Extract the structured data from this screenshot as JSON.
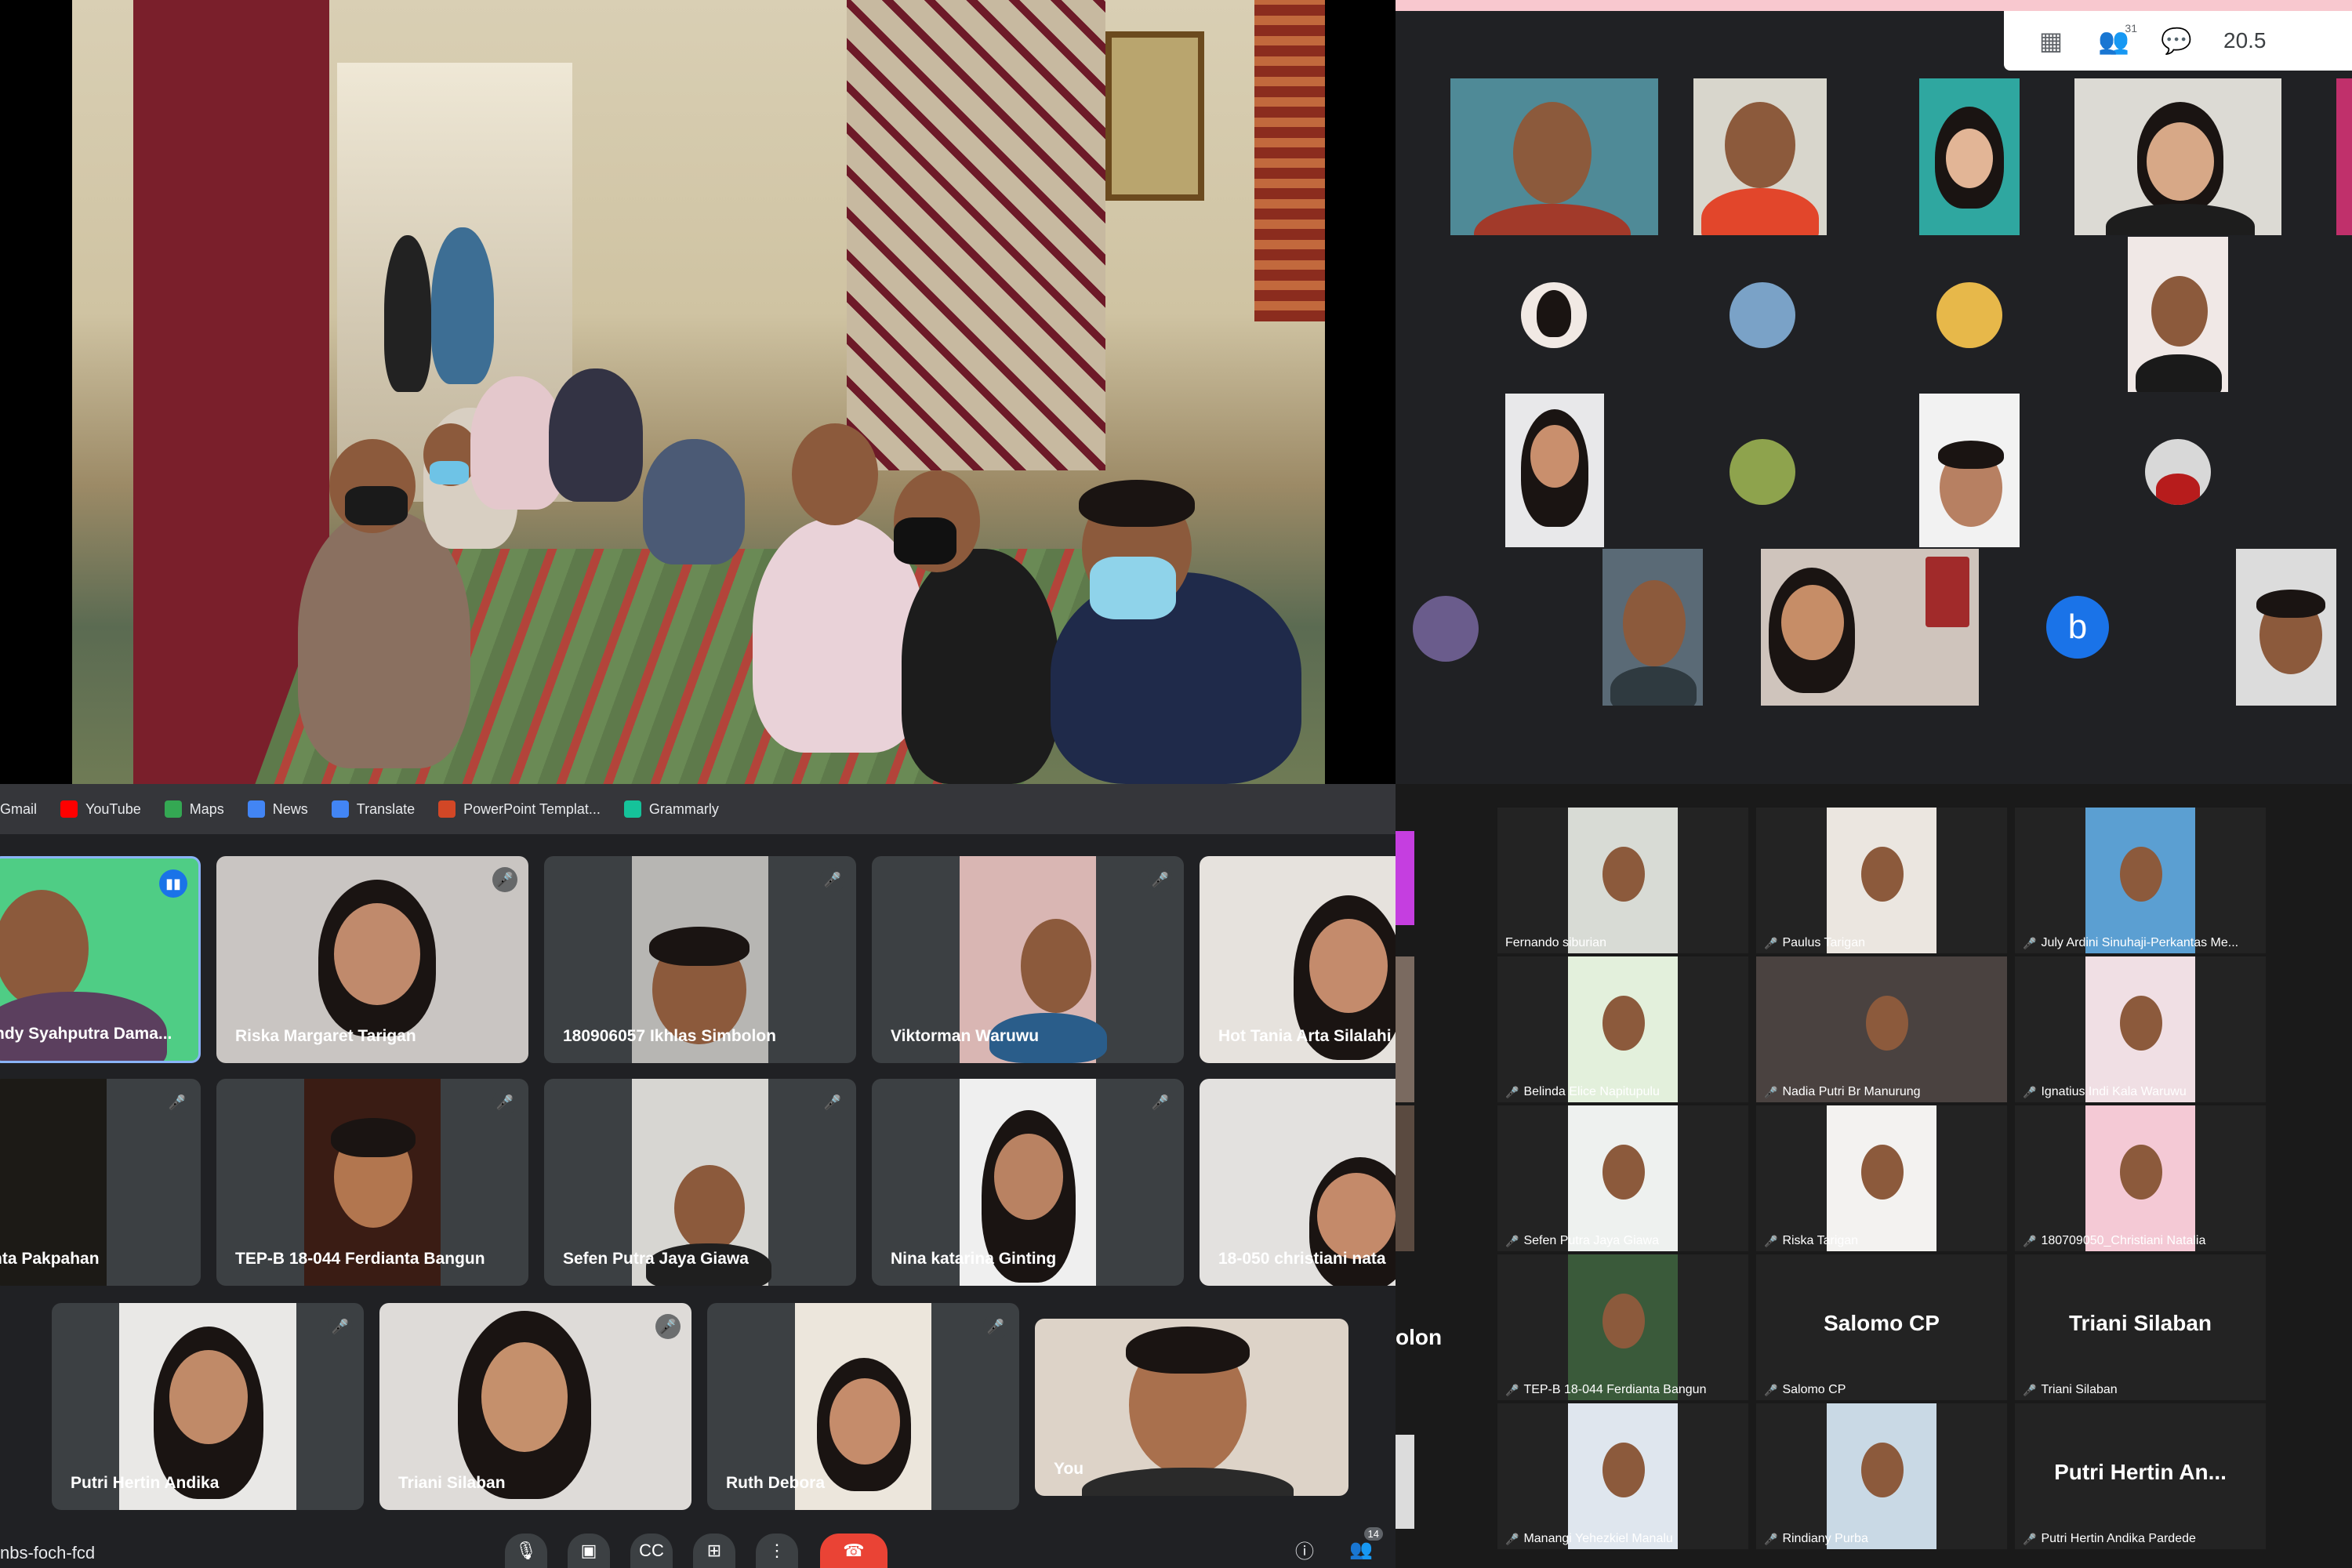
{
  "bookmarks": [
    {
      "label": "Gmail",
      "color": "#ea4335"
    },
    {
      "label": "YouTube",
      "color": "#ff0000"
    },
    {
      "label": "Maps",
      "color": "#34a853"
    },
    {
      "label": "News",
      "color": "#4285f4"
    },
    {
      "label": "Translate",
      "color": "#4285f4"
    },
    {
      "label": "PowerPoint Templat...",
      "color": "#d24726"
    },
    {
      "label": "Grammarly",
      "color": "#15c39a"
    }
  ],
  "meet": {
    "participants": [
      {
        "name": "ndy Syahputra Dama..."
      },
      {
        "name": "Riska Margaret Tarigan"
      },
      {
        "name": "180906057 Ikhlas Simbolon"
      },
      {
        "name": "Viktorman Waruwu"
      },
      {
        "name": "Hot Tania Arta Silalahi"
      },
      {
        "name": "nta Pakpahan"
      },
      {
        "name": "TEP-B 18-044 Ferdianta Bangun"
      },
      {
        "name": "Sefen Putra Jaya Giawa"
      },
      {
        "name": "Nina katarina Ginting"
      },
      {
        "name": "18-050 christiani nata"
      },
      {
        "name": "Putri Hertin Andika"
      },
      {
        "name": "Triani Silaban"
      },
      {
        "name": "Ruth Debora"
      },
      {
        "name": "You"
      }
    ],
    "meeting_code": "nbs-foch-fcd",
    "people_count": "14"
  },
  "zoom_grid": {
    "toolbar": {
      "people_count": "31",
      "clock": "20.5"
    },
    "letter_tile": "b"
  },
  "zoom": {
    "tiles": [
      {
        "name": "Fernando siburian"
      },
      {
        "name": "Paulus Tarigan"
      },
      {
        "name": "July Ardini Sinuhaji-Perkantas Me..."
      },
      {
        "name": "Belinda Elice Napitupulu"
      },
      {
        "name": "Nadia Putri Br Manurung"
      },
      {
        "name": "Ignatius Indi Kala Waruwu"
      },
      {
        "name": "Sefen Putra Jaya Giawa"
      },
      {
        "name": "Riska Tarigan"
      },
      {
        "name": "180709050_Christiani Natalia"
      },
      {
        "name": "TEP-B 18-044 Ferdianta Bangun"
      },
      {
        "name": "Salomo CP",
        "big": "Salomo CP"
      },
      {
        "name": "Triani Silaban",
        "big": "Triani Silaban"
      },
      {
        "name": "Manangi Yehezkiel Manalu"
      },
      {
        "name": "Rindiany Purba"
      },
      {
        "name": "Putri Hertin Andika Pardede",
        "big": "Putri Hertin An..."
      }
    ],
    "partial_big": "olon"
  }
}
